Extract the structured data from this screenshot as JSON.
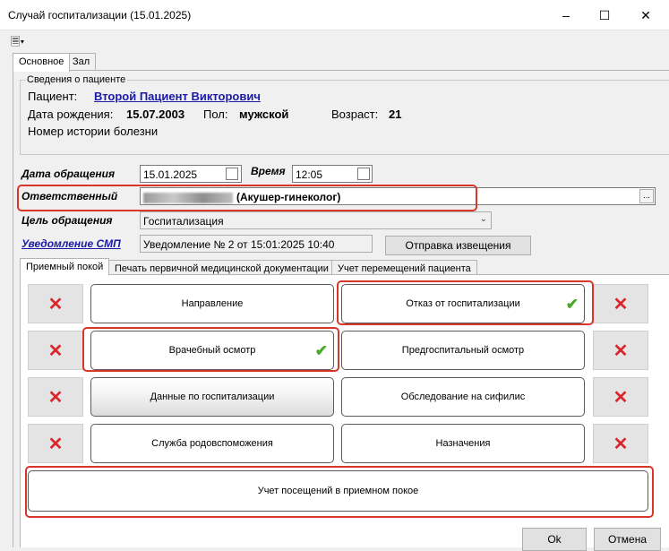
{
  "window": {
    "title": "Случай госпитализации (15.01.2025)"
  },
  "toolbar": {
    "icon": "document-report-icon"
  },
  "top_tabs": [
    {
      "label": "Основное"
    },
    {
      "label": "Зал"
    }
  ],
  "patient_info": {
    "group_title": "Сведения о пациенте",
    "patient_label": "Пациент:",
    "patient_name": "Второй Пациент Викторович",
    "dob_label": "Дата рождения:",
    "dob_value": "15.07.2003",
    "sex_label": "Пол:",
    "sex_value": "мужской",
    "age_label": "Возраст:",
    "age_value": "21",
    "history_label": "Номер истории болезни"
  },
  "form": {
    "date_label": "Дата обращения",
    "date_value": "15.01.2025",
    "time_label": "Время",
    "time_value": "12:05",
    "responsible_label": "Ответственный",
    "responsible_value": "(Акушер-гинеколог)",
    "purpose_label": "Цель обращения",
    "purpose_value": "Госпитализация",
    "notice_label": "Уведомление СМП",
    "notice_value": "Уведомление № 2 от 15:01:2025 10:40",
    "send_notice_button": "Отправка извещения"
  },
  "inner_tabs": [
    {
      "label": "Приемный покой"
    },
    {
      "label": "Печать первичной медицинской документации"
    },
    {
      "label": "Учет перемещений пациента"
    }
  ],
  "buttons": {
    "referral": "Направление",
    "refusal": "Отказ от госпитализации",
    "doctor_exam": "Врачебный осмотр",
    "prehospital_exam": "Предгоспитальный осмотр",
    "hosp_data": "Данные по госпитализации",
    "syphilis_exam": "Обследование на сифилис",
    "obstetric_service": "Служба родовспоможения",
    "prescriptions": "Назначения",
    "visits_log": "Учет посещений в приемном покое"
  },
  "dialog": {
    "ok": "Ok",
    "cancel": "Отмена"
  },
  "colors": {
    "accent_red": "#d9362a",
    "check_green": "#4aa82a",
    "link_blue": "#1a1aa8"
  }
}
